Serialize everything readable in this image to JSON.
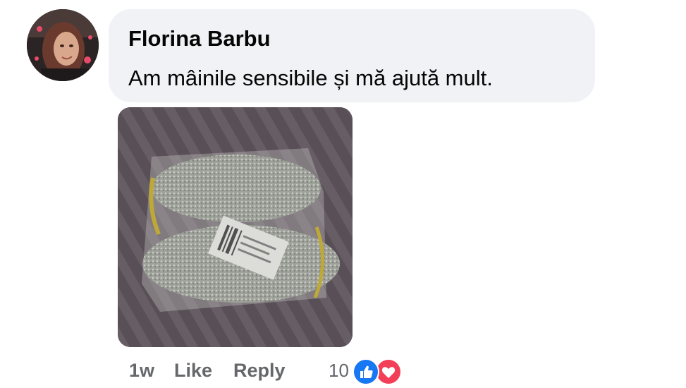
{
  "comment": {
    "author": "Florina Barbu",
    "text": "Am mâinile sensibile și mă ajută mult.",
    "time": "1w",
    "like_label": "Like",
    "reply_label": "Reply",
    "reaction_count": "10",
    "reactions": [
      "like-icon",
      "love-icon"
    ]
  },
  "colors": {
    "bubble": "#f0f2f5",
    "secondary_text": "#65676b",
    "like_blue": "#1877f2",
    "love_red": "#f33e58"
  }
}
